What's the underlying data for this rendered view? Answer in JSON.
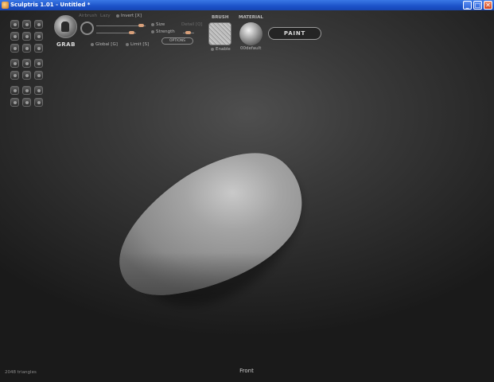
{
  "window": {
    "title": "Sculptris 1.01 - Untitled *",
    "minimize": "_",
    "maximize": "□",
    "close": "✕"
  },
  "tool": {
    "name": "GRAB",
    "airbrush_label": "Airbrush",
    "lazy_label": "Lazy",
    "invert_label": "Invert [X]",
    "size_label": "Size",
    "strength_label": "Strength",
    "detail_label": "Detail [Q]",
    "options_label": "OPTIONS",
    "global_label": "Global [G]",
    "limit_label": "Limit [S]"
  },
  "brush": {
    "header": "BRUSH",
    "enable_label": "Enable"
  },
  "material": {
    "header": "MATERIAL",
    "name": "00default"
  },
  "paint_label": "PAINT",
  "viewport": {
    "view_name": "Front",
    "status": "2048 triangles"
  },
  "colors": {
    "titlebar": "#1c52c8",
    "slider_knob": "#d9a07a",
    "model": "#9a9a9a"
  }
}
